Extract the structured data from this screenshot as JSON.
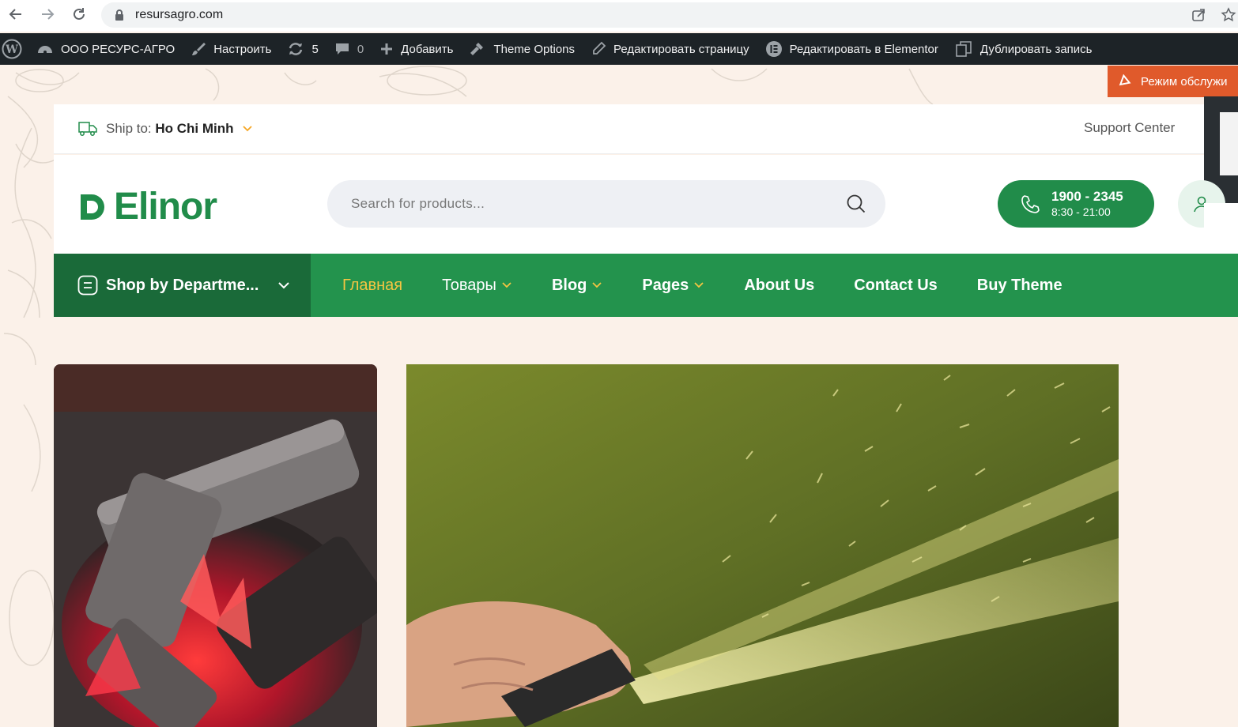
{
  "browser": {
    "url": "resursagro.com"
  },
  "wp_admin_bar": {
    "site_name": "ООО РЕСУРС-АГРО",
    "customize": "Настроить",
    "updates_count": "5",
    "comments_count": "0",
    "add_new": "Добавить",
    "theme_options": "Theme Options",
    "edit_page": "Редактировать страницу",
    "edit_elementor": "Редактировать в Elementor",
    "duplicate": "Дублировать запись"
  },
  "maintenance_badge": "Режим обслужи",
  "top_strip": {
    "ship_label": "Ship to:",
    "ship_city": "Ho Chi Minh",
    "support": "Support Center"
  },
  "header": {
    "logo_text": "Elinor",
    "search_placeholder": "Search for products...",
    "phone_number": "1900 - 2345",
    "phone_hours": "8:30 - 21:00"
  },
  "nav": {
    "department": "Shop by Departme...",
    "items": [
      {
        "label": "Главная",
        "active": true,
        "dropdown": false
      },
      {
        "label": "Товары",
        "active": false,
        "dropdown": true
      },
      {
        "label": "Blog",
        "active": false,
        "dropdown": true
      },
      {
        "label": "Pages",
        "active": false,
        "dropdown": true
      },
      {
        "label": "About Us",
        "active": false,
        "dropdown": false
      },
      {
        "label": "Contact Us",
        "active": false,
        "dropdown": false
      },
      {
        "label": "Buy Theme",
        "active": false,
        "dropdown": false
      }
    ]
  },
  "colors": {
    "brand_green": "#218c4a",
    "dark_green": "#1a6a39",
    "active_nav": "#f5c542",
    "admin_bar": "#1d2327",
    "maintenance": "#e05a2b",
    "page_bg": "#fbf1e9"
  },
  "icons": {
    "back": "arrow-left-icon",
    "forward": "arrow-right-icon",
    "reload": "reload-icon",
    "lock": "lock-icon",
    "share": "share-icon",
    "bookmark": "star-icon",
    "truck": "truck-icon",
    "search": "search-icon",
    "phone": "phone-icon",
    "user": "user-icon",
    "menu": "menu-icon"
  }
}
